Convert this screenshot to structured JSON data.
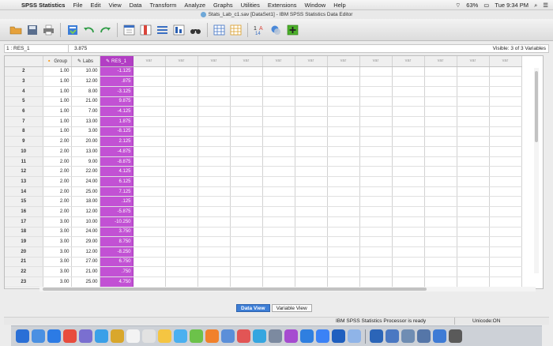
{
  "menubar": {
    "app_name": "SPSS Statistics",
    "items": [
      "File",
      "Edit",
      "View",
      "Data",
      "Transform",
      "Analyze",
      "Graphs",
      "Utilities",
      "Extensions",
      "Window",
      "Help"
    ],
    "battery": "63%",
    "clock": "Tue 9:34 PM"
  },
  "window": {
    "title": "Stats_Lab_c1.sav [DataSet1] - IBM SPSS Statistics Data Editor"
  },
  "toolbar": {
    "icons": [
      "open-icon",
      "save-icon",
      "print-icon",
      "recall-dialog-icon",
      "undo-icon",
      "redo-icon",
      "goto-case-icon",
      "goto-variable-icon",
      "variables-icon",
      "run-descriptives-icon",
      "find-icon",
      "insert-cases-icon",
      "insert-variable-icon",
      "split-file-icon",
      "weight-cases-icon",
      "select-cases-icon",
      "value-labels-icon",
      "use-variable-sets-icon",
      "show-all-variables-icon"
    ]
  },
  "cell_editor": {
    "reference": "1 : RES_1",
    "value": "3.875",
    "visible_label": "Visible: 3 of 3 Variables"
  },
  "grid": {
    "columns": [
      {
        "name": "Group",
        "icon": "nominal-icon"
      },
      {
        "name": "Labs",
        "icon": "scale-icon"
      },
      {
        "name": "RES_1",
        "icon": "scale-icon"
      }
    ],
    "empty_column_label": "var",
    "empty_column_count": 12,
    "rows": [
      {
        "n": "2",
        "group": "1.00",
        "labs": "10.00",
        "res": "-1.125"
      },
      {
        "n": "3",
        "group": "1.00",
        "labs": "12.00",
        "res": ".875"
      },
      {
        "n": "4",
        "group": "1.00",
        "labs": "8.00",
        "res": "-3.125"
      },
      {
        "n": "5",
        "group": "1.00",
        "labs": "21.00",
        "res": "9.875"
      },
      {
        "n": "6",
        "group": "1.00",
        "labs": "7.00",
        "res": "-4.125"
      },
      {
        "n": "7",
        "group": "1.00",
        "labs": "13.00",
        "res": "1.875"
      },
      {
        "n": "8",
        "group": "1.00",
        "labs": "3.00",
        "res": "-8.125"
      },
      {
        "n": "9",
        "group": "2.00",
        "labs": "20.00",
        "res": "2.125"
      },
      {
        "n": "10",
        "group": "2.00",
        "labs": "13.00",
        "res": "-4.875"
      },
      {
        "n": "11",
        "group": "2.00",
        "labs": "9.00",
        "res": "-8.875"
      },
      {
        "n": "12",
        "group": "2.00",
        "labs": "22.00",
        "res": "4.125"
      },
      {
        "n": "13",
        "group": "2.00",
        "labs": "24.00",
        "res": "6.125"
      },
      {
        "n": "14",
        "group": "2.00",
        "labs": "25.00",
        "res": "7.125"
      },
      {
        "n": "15",
        "group": "2.00",
        "labs": "18.00",
        "res": ".125"
      },
      {
        "n": "16",
        "group": "2.00",
        "labs": "12.00",
        "res": "-5.875"
      },
      {
        "n": "17",
        "group": "3.00",
        "labs": "10.00",
        "res": "-10.250"
      },
      {
        "n": "18",
        "group": "3.00",
        "labs": "24.00",
        "res": "3.750"
      },
      {
        "n": "19",
        "group": "3.00",
        "labs": "29.00",
        "res": "8.750"
      },
      {
        "n": "20",
        "group": "3.00",
        "labs": "12.00",
        "res": "-8.250"
      },
      {
        "n": "21",
        "group": "3.00",
        "labs": "27.00",
        "res": "6.750"
      },
      {
        "n": "22",
        "group": "3.00",
        "labs": "21.00",
        "res": ".750"
      },
      {
        "n": "23",
        "group": "3.00",
        "labs": "25.00",
        "res": "4.750"
      }
    ]
  },
  "tabs": {
    "data_view": "Data View",
    "variable_view": "Variable View"
  },
  "status": {
    "processor": "IBM SPSS Statistics Processor is ready",
    "unicode": "Unicode:ON"
  },
  "dock": {
    "colors": [
      "#2a6fd6",
      "#4a90e2",
      "#2c7be5",
      "#e84c3d",
      "#7a6fd0",
      "#3aa0e8",
      "#d9a72c",
      "#f3f3f3",
      "#e2e2e2",
      "#f5c542",
      "#4ab0f0",
      "#6cc24a",
      "#f1812b",
      "#5b8fd9",
      "#e25555",
      "#35a6e0",
      "#7c8aa0",
      "#a64bd0",
      "#2f7fe0",
      "#3b82f6",
      "#1f5fbf",
      "#8fb4e8",
      "#2b65b8",
      "#4a78c2",
      "#6f8db3",
      "#5576a8",
      "#3e7bd5",
      "#5a5a5a"
    ]
  }
}
